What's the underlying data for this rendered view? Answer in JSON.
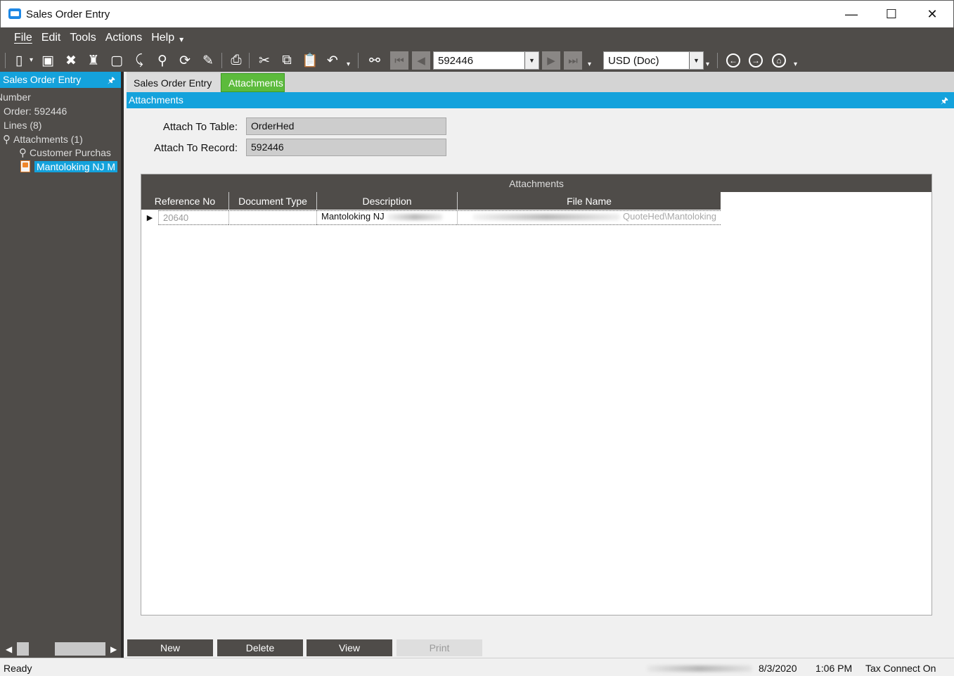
{
  "window": {
    "title": "Sales Order Entry",
    "minimize": "—",
    "maximize": "☐",
    "close": "✕"
  },
  "menu": {
    "file": "File",
    "edit": "Edit",
    "tools": "Tools",
    "actions": "Actions",
    "help": "Help"
  },
  "toolbar": {
    "record_value": "592446",
    "currency_value": "USD (Doc)"
  },
  "left_pane": {
    "header": "Sales Order Entry",
    "items": [
      {
        "label": "Number"
      },
      {
        "label": "Order: 592446"
      },
      {
        "label": "Lines (8)"
      },
      {
        "label": "Attachments (1)"
      },
      {
        "label": "Customer Purchas"
      },
      {
        "label": "Mantoloking NJ M"
      }
    ]
  },
  "tabs": [
    {
      "label": "Sales Order Entry"
    },
    {
      "label": "Attachments"
    }
  ],
  "panel": {
    "header": "Attachments",
    "attach_to_table_label": "Attach To Table:",
    "attach_to_table_value": "OrderHed",
    "attach_to_record_label": "Attach To Record:",
    "attach_to_record_value": "592446"
  },
  "grid": {
    "caption": "Attachments",
    "columns": [
      "Reference No",
      "Document Type",
      "Description",
      "File Name"
    ],
    "rows": [
      {
        "reference_no": "20640",
        "document_type": "",
        "description": "Mantoloking NJ",
        "file_name": "QuoteHed\\Mantoloking"
      }
    ]
  },
  "buttons": {
    "new": "New",
    "delete": "Delete",
    "view": "View",
    "print": "Print"
  },
  "status": {
    "state": "Ready",
    "date": "8/3/2020",
    "time": "1:06 PM",
    "tax": "Tax Connect On"
  }
}
